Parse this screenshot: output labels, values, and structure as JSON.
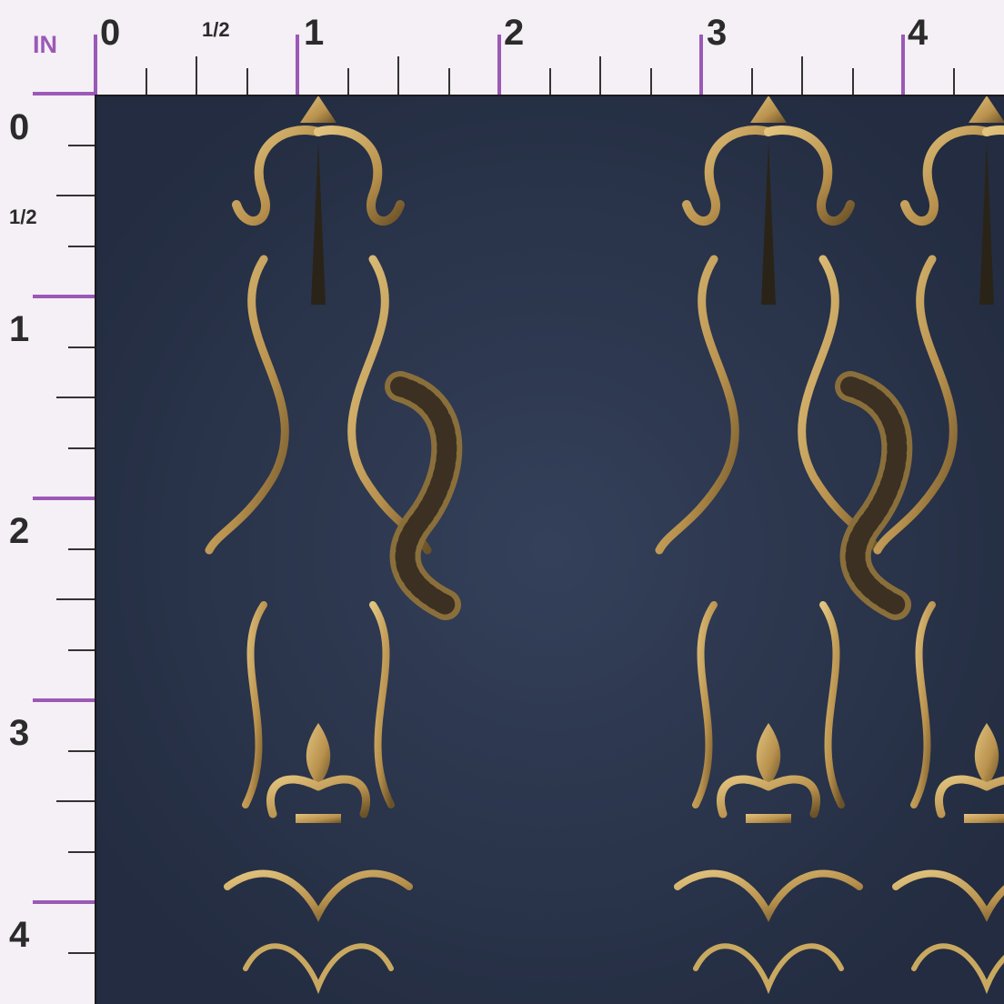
{
  "ruler": {
    "unit_label": "IN",
    "top_labels": [
      "0",
      "1/2",
      "1",
      "2",
      "3",
      "4"
    ],
    "left_labels": [
      "0",
      "1/2",
      "1",
      "2",
      "3",
      "4"
    ]
  },
  "pattern": {
    "background_color": "#2c3750",
    "ornament_color": "#c9a860",
    "motif": "gold damask with dragons and fleur-de-lis"
  },
  "colors": {
    "ruler_accent": "#9b59b6",
    "ruler_ink": "#2b2b2b",
    "page_background": "#f5eff6"
  }
}
